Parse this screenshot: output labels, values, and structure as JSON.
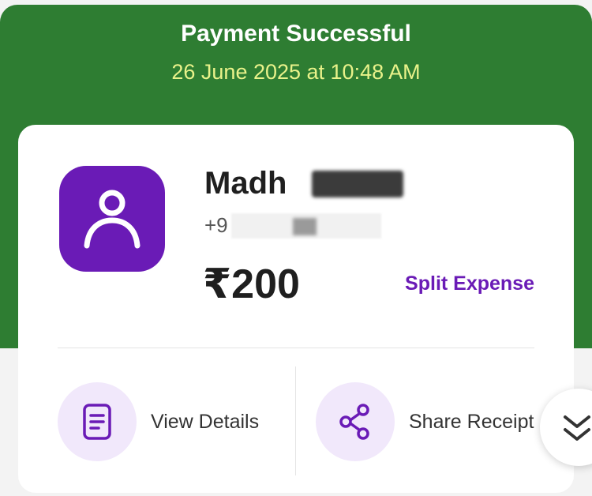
{
  "header": {
    "title": "Payment Successful",
    "datetime": "26 June 2025 at 10:48 AM"
  },
  "payee": {
    "name": "Madh",
    "phone": "+9"
  },
  "payment": {
    "amount": "₹200",
    "split_label": "Split Expense"
  },
  "actions": {
    "view_details": "View Details",
    "share_receipt": "Share Receipt"
  },
  "colors": {
    "header_green": "#2e7d32",
    "accent_purple": "#6a1bb6",
    "datetime_yellow": "#e9f28a"
  },
  "icons": {
    "avatar": "person-icon",
    "details": "document-icon",
    "share": "share-icon",
    "scroll": "double-chevron-down-icon"
  }
}
